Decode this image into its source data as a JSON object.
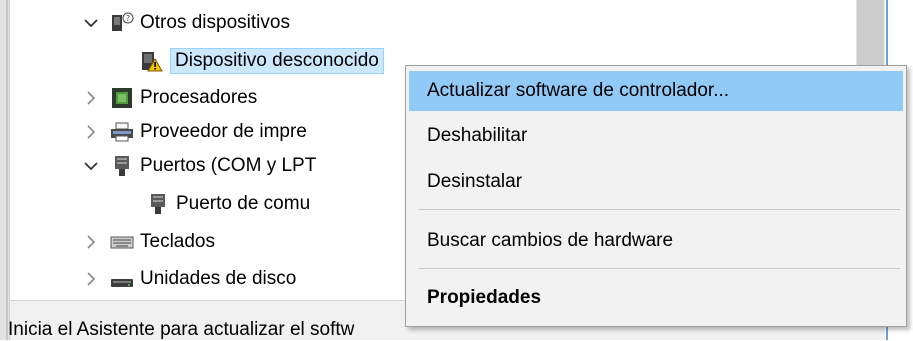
{
  "tree": {
    "items": [
      {
        "label": "Otros dispositivos",
        "expanded": true,
        "icon": "unknown-device-icon"
      },
      {
        "label": "Dispositivo desconocido",
        "icon": "warning-device-icon",
        "selected": true
      },
      {
        "label": "Procesadores",
        "expanded": false,
        "icon": "processor-icon"
      },
      {
        "label": "Proveedor de impre",
        "expanded": false,
        "icon": "printer-icon"
      },
      {
        "label": "Puertos (COM y LPT",
        "expanded": true,
        "icon": "port-icon"
      },
      {
        "label": "Puerto de comu",
        "icon": "port-icon"
      },
      {
        "label": "Teclados",
        "expanded": false,
        "icon": "keyboard-icon"
      },
      {
        "label": "Unidades de disco",
        "expanded": false,
        "icon": "disk-drive-icon"
      }
    ]
  },
  "context_menu": {
    "items": [
      {
        "label": "Actualizar software de controlador...",
        "highlighted": true
      },
      {
        "label": "Deshabilitar"
      },
      {
        "label": "Desinstalar"
      },
      {
        "label": "Buscar cambios de hardware"
      },
      {
        "label": "Propiedades",
        "bold": true
      }
    ]
  },
  "status_bar": {
    "text": "Inicia el Asistente para actualizar el softw"
  }
}
